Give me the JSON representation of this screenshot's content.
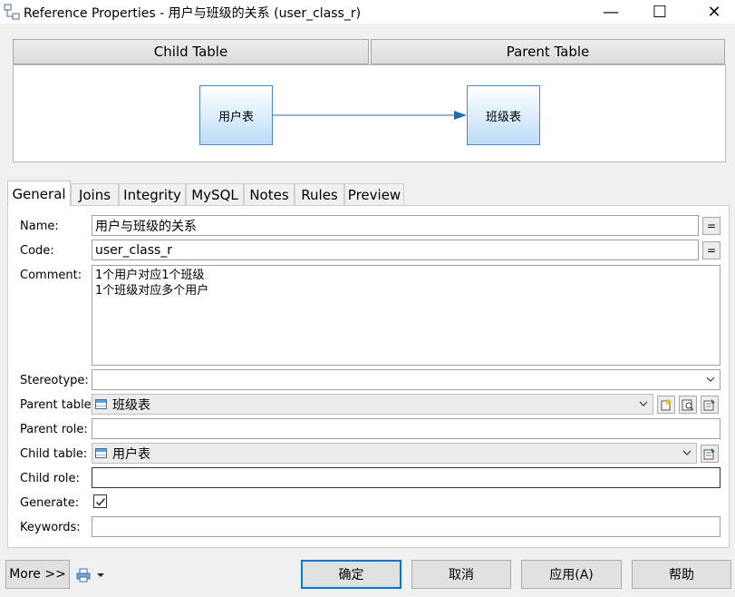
{
  "window": {
    "title": "Reference Properties - 用户与班级的关系 (user_class_r)",
    "minimize": "—",
    "maximize": "☐",
    "close": "✕"
  },
  "header": {
    "child_table": "Child Table",
    "parent_table": "Parent Table"
  },
  "diagram": {
    "child_box": "用户表",
    "parent_box": "班级表"
  },
  "tabs": [
    "General",
    "Joins",
    "Integrity",
    "MySQL",
    "Notes",
    "Rules",
    "Preview"
  ],
  "active_tab": "General",
  "form": {
    "name_label": "Name:",
    "name_value": "用户与班级的关系",
    "code_label": "Code:",
    "code_value": "user_class_r",
    "equals_button": "=",
    "comment_label": "Comment:",
    "comment_lines": [
      "1个用户对应1个班级",
      "1个班级对应多个用户"
    ],
    "stereotype_label": "Stereotype:",
    "stereotype_value": "",
    "parent_table_label": "Parent table:",
    "parent_table_value": "班级表",
    "parent_role_label": "Parent role:",
    "parent_role_value": "",
    "child_table_label": "Child table:",
    "child_table_value": "用户表",
    "child_role_label": "Child role:",
    "child_role_value": "",
    "generate_label": "Generate:",
    "generate_checked": true,
    "keywords_label": "Keywords:",
    "keywords_value": ""
  },
  "footer": {
    "more": "More >>",
    "ok": "确定",
    "cancel": "取消",
    "apply": "应用(A)",
    "help": "帮助"
  },
  "colors": {
    "accent": "#0078d7",
    "table_box_border": "#4a89c8",
    "arrow": "#1f6fb5"
  }
}
